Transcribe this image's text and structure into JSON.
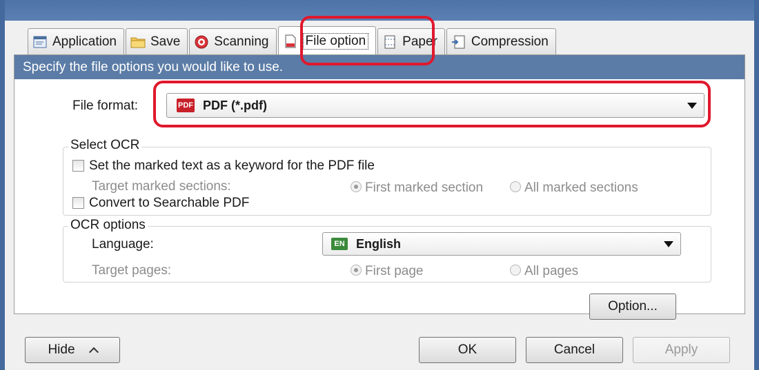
{
  "tabs": [
    {
      "label": "Application",
      "icon": "application-icon"
    },
    {
      "label": "Save",
      "icon": "folder-icon"
    },
    {
      "label": "Scanning",
      "icon": "scanning-icon"
    },
    {
      "label": "File option",
      "icon": "file-icon",
      "active": true
    },
    {
      "label": "Paper",
      "icon": "paper-icon"
    },
    {
      "label": "Compression",
      "icon": "compression-icon"
    }
  ],
  "section_header": "Specify the file options you would like to use.",
  "file_format": {
    "label": "File format:",
    "chip": "PDF",
    "value": "PDF (*.pdf)"
  },
  "select_ocr": {
    "title": "Select OCR",
    "keyword_checkbox": "Set the marked text as a keyword for the PDF file",
    "keyword_checked": false,
    "target_label": "Target marked sections:",
    "options": [
      "First marked section",
      "All marked sections"
    ],
    "selected": "First marked section",
    "searchable_checkbox": "Convert to Searchable PDF",
    "searchable_checked": false
  },
  "ocr_options": {
    "title": "OCR options",
    "language_label": "Language:",
    "language_chip": "EN",
    "language_value": "English",
    "target_pages_label": "Target pages:",
    "page_options": [
      "First page",
      "All pages"
    ],
    "selected": "First page"
  },
  "buttons": {
    "option": "Option...",
    "hide": "Hide",
    "ok": "OK",
    "cancel": "Cancel",
    "apply": "Apply"
  },
  "colors": {
    "header_bg": "#5b7ca6",
    "highlight": "#e0182d",
    "pdf_chip": "#c8202a",
    "en_chip": "#3a8a3a"
  }
}
